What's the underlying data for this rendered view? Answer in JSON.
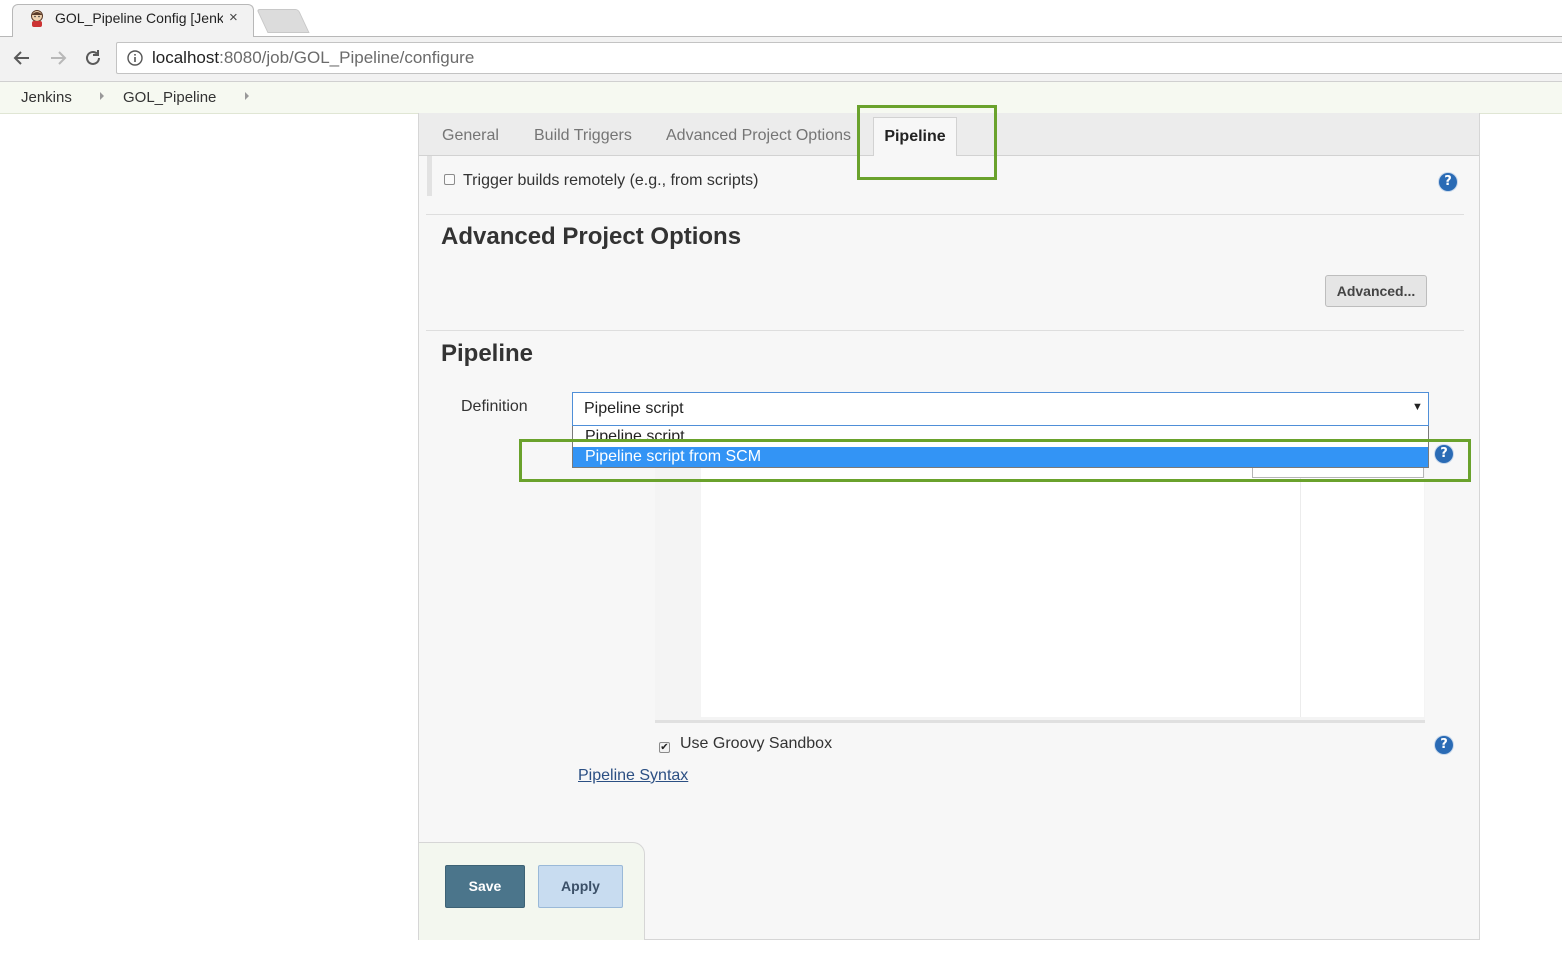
{
  "browser": {
    "tab_title": "GOL_Pipeline Config [Jenkins]",
    "tab_close": "×",
    "url_host": "localhost",
    "url_rest": ":8080/job/GOL_Pipeline/configure"
  },
  "breadcrumb": {
    "items": [
      "Jenkins",
      "GOL_Pipeline"
    ]
  },
  "config_tabs": {
    "general": "General",
    "build_triggers": "Build Triggers",
    "advanced_project_options": "Advanced Project Options",
    "pipeline": "Pipeline"
  },
  "triggers": {
    "trigger_remotely_label": "Trigger builds remotely (e.g., from scripts)",
    "trigger_remotely_checked": false
  },
  "advanced_section": {
    "title": "Advanced Project Options",
    "advanced_button": "Advanced..."
  },
  "pipeline_section": {
    "title": "Pipeline",
    "definition_label": "Definition",
    "definition_value": "Pipeline script",
    "definition_options": [
      "Pipeline script",
      "Pipeline script from SCM"
    ],
    "highlighted_option": "Pipeline script from SCM",
    "groovy_sandbox_label": "Use Groovy Sandbox",
    "groovy_sandbox_checked": true,
    "pipeline_syntax_link": "Pipeline Syntax"
  },
  "buttons": {
    "save": "Save",
    "apply": "Apply"
  },
  "help_glyph": "?",
  "colors": {
    "highlight_box": "#6aa22c",
    "selected_option": "#3394f5",
    "save_button": "#4b758b",
    "apply_button": "#c8dcf0",
    "help_icon": "#2a6bb5"
  }
}
